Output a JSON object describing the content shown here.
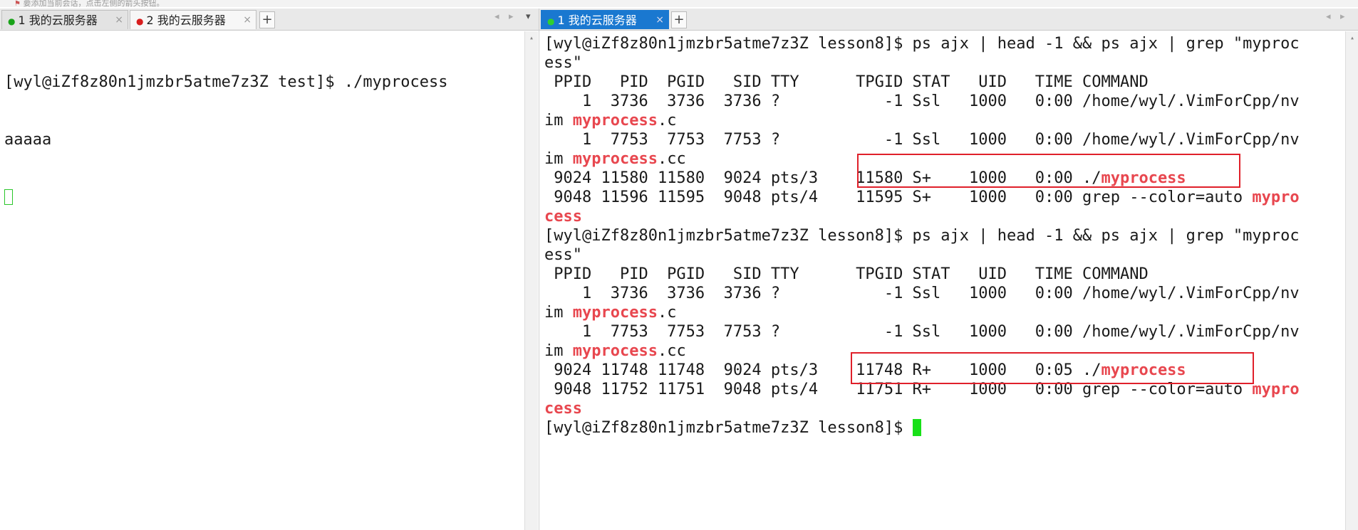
{
  "top_hint": "要添加当前会话，点击左侧的箭头按钮。",
  "left_tabs": [
    {
      "dot_color": "#19a319",
      "label": "1 我的云服务器",
      "active": false
    },
    {
      "dot_color": "#d81e1e",
      "label": "2 我的云服务器",
      "active": false
    }
  ],
  "right_tabs": [
    {
      "dot_color": "#30d030",
      "label": "1 我的云服务器",
      "active": true
    }
  ],
  "tab_close_symbol": "×",
  "add_tab_symbol": "+",
  "nav": {
    "prev": "◂",
    "next": "▸",
    "menu": "▾"
  },
  "scroll_up": "▴",
  "left_terminal": {
    "lines": [
      "[wyl@iZf8z80n1jmzbr5atme7z3Z test]$ ./myprocess",
      "aaaaa"
    ]
  },
  "right_terminal": {
    "lines": [
      {
        "parts": [
          "[wyl@iZf8z80n1jmzbr5atme7z3Z lesson8]$ ps ajx | head -1 && ps ajx | grep \"myproc"
        ]
      },
      {
        "parts": [
          "ess\""
        ]
      },
      {
        "parts": [
          " PPID   PID  PGID   SID TTY      TPGID STAT   UID   TIME COMMAND"
        ]
      },
      {
        "parts": [
          "    1  3736  3736  3736 ?           -1 Ssl   1000   0:00 /home/wyl/.VimForCpp/nv"
        ]
      },
      {
        "parts": [
          "im ",
          "myprocess",
          ".c"
        ]
      },
      {
        "parts": [
          "    1  7753  7753  7753 ?           -1 Ssl   1000   0:00 /home/wyl/.VimForCpp/nv"
        ]
      },
      {
        "parts": [
          "im ",
          "myprocess",
          ".cc"
        ]
      },
      {
        "parts": [
          " 9024 11580 11580  9024 pts/3    11580 S+    1000   0:00 ./",
          "myprocess"
        ]
      },
      {
        "parts": [
          " 9048 11596 11595  9048 pts/4    11595 S+    1000   0:00 grep --color=auto ",
          "mypro"
        ]
      },
      {
        "parts": [
          "",
          "cess"
        ]
      },
      {
        "parts": [
          "[wyl@iZf8z80n1jmzbr5atme7z3Z lesson8]$ ps ajx | head -1 && ps ajx | grep \"myproc"
        ]
      },
      {
        "parts": [
          "ess\""
        ]
      },
      {
        "parts": [
          " PPID   PID  PGID   SID TTY      TPGID STAT   UID   TIME COMMAND"
        ]
      },
      {
        "parts": [
          "    1  3736  3736  3736 ?           -1 Ssl   1000   0:00 /home/wyl/.VimForCpp/nv"
        ]
      },
      {
        "parts": [
          "im ",
          "myprocess",
          ".c"
        ]
      },
      {
        "parts": [
          "    1  7753  7753  7753 ?           -1 Ssl   1000   0:00 /home/wyl/.VimForCpp/nv"
        ]
      },
      {
        "parts": [
          "im ",
          "myprocess",
          ".cc"
        ]
      },
      {
        "parts": [
          " 9024 11748 11748  9024 pts/3    11748 R+    1000   0:05 ./",
          "myprocess"
        ]
      },
      {
        "parts": [
          " 9048 11752 11751  9048 pts/4    11751 R+    1000   0:00 grep --color=auto ",
          "mypro"
        ]
      },
      {
        "parts": [
          "",
          "cess"
        ]
      },
      {
        "parts": [
          "[wyl@iZf8z80n1jmzbr5atme7z3Z lesson8]$ "
        ]
      }
    ]
  },
  "colors": {
    "highlight": "#e8474f",
    "cursor": "#18e018",
    "active_tab": "#1a78d0",
    "annotation_box": "#e0202a"
  }
}
